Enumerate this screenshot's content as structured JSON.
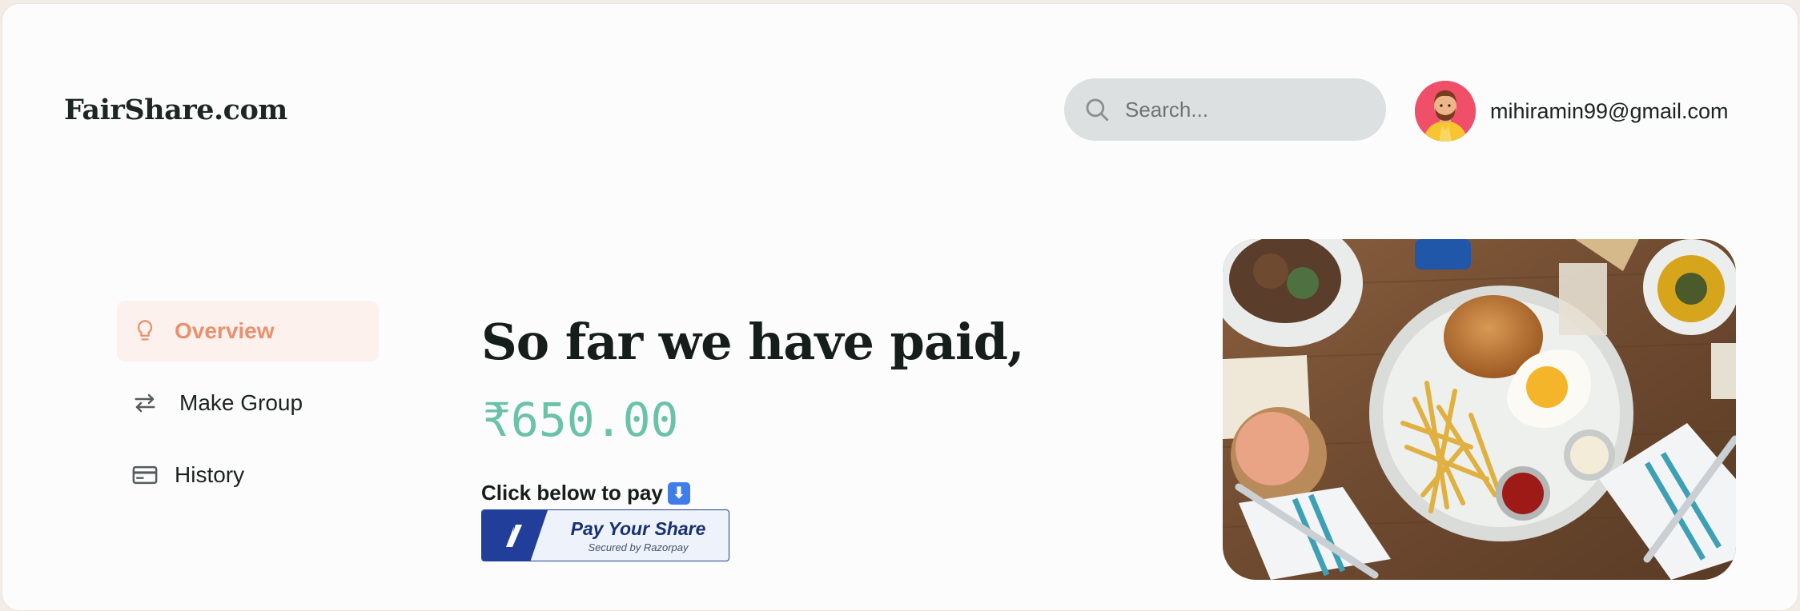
{
  "header": {
    "brand": "FairShare.com",
    "search": {
      "placeholder": "Search...",
      "value": ""
    },
    "user": {
      "email": "mihiramin99@gmail.com"
    }
  },
  "sidebar": {
    "items": [
      {
        "label": "Overview",
        "icon": "lightbulb-icon",
        "active": true
      },
      {
        "label": "Make Group",
        "icon": "arrows-swap-icon",
        "active": false
      },
      {
        "label": "History",
        "icon": "credit-card-icon",
        "active": false
      }
    ]
  },
  "main": {
    "headline": "So far we have paid,",
    "amount": "₹650.00",
    "pay_caption": "Click below to pay",
    "pay_button": {
      "title": "Pay Your Share",
      "subtitle": "Secured by Razorpay"
    }
  },
  "colors": {
    "accent": "#e9916f",
    "active_bg": "#fcf1ec",
    "amount": "#6ac2a8",
    "razorpay_blue": "#1c3f92"
  }
}
